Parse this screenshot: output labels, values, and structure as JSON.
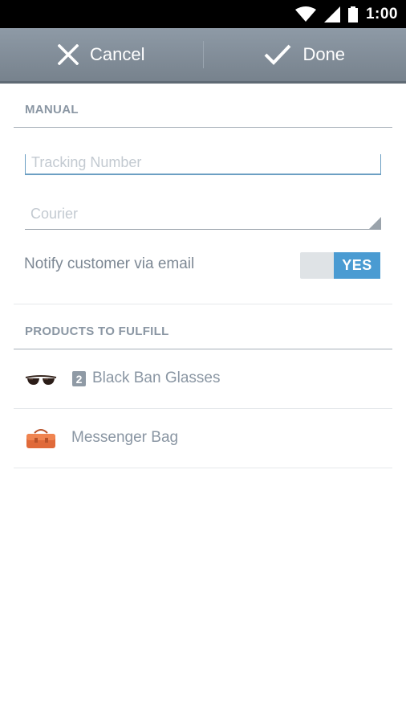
{
  "status_bar": {
    "time": "1:00",
    "icons": [
      "wifi-icon",
      "signal-icon",
      "battery-icon"
    ]
  },
  "action_bar": {
    "cancel_label": "Cancel",
    "done_label": "Done"
  },
  "manual": {
    "heading": "MANUAL",
    "tracking_placeholder": "Tracking Number",
    "courier_placeholder": "Courier",
    "notify_label": "Notify customer via email",
    "notify_toggle": "YES"
  },
  "products": {
    "heading": "PRODUCTS TO FULFILL",
    "items": [
      {
        "name": "Black Ban Glasses",
        "quantity": "2",
        "icon": "sunglasses-icon"
      },
      {
        "name": "Messenger Bag",
        "icon": "bag-icon"
      }
    ]
  },
  "colors": {
    "action_bar": "#818c97",
    "accent": "#4a9bd2",
    "input_focus": "#6c9fc3",
    "section_text": "#8a96a3"
  }
}
